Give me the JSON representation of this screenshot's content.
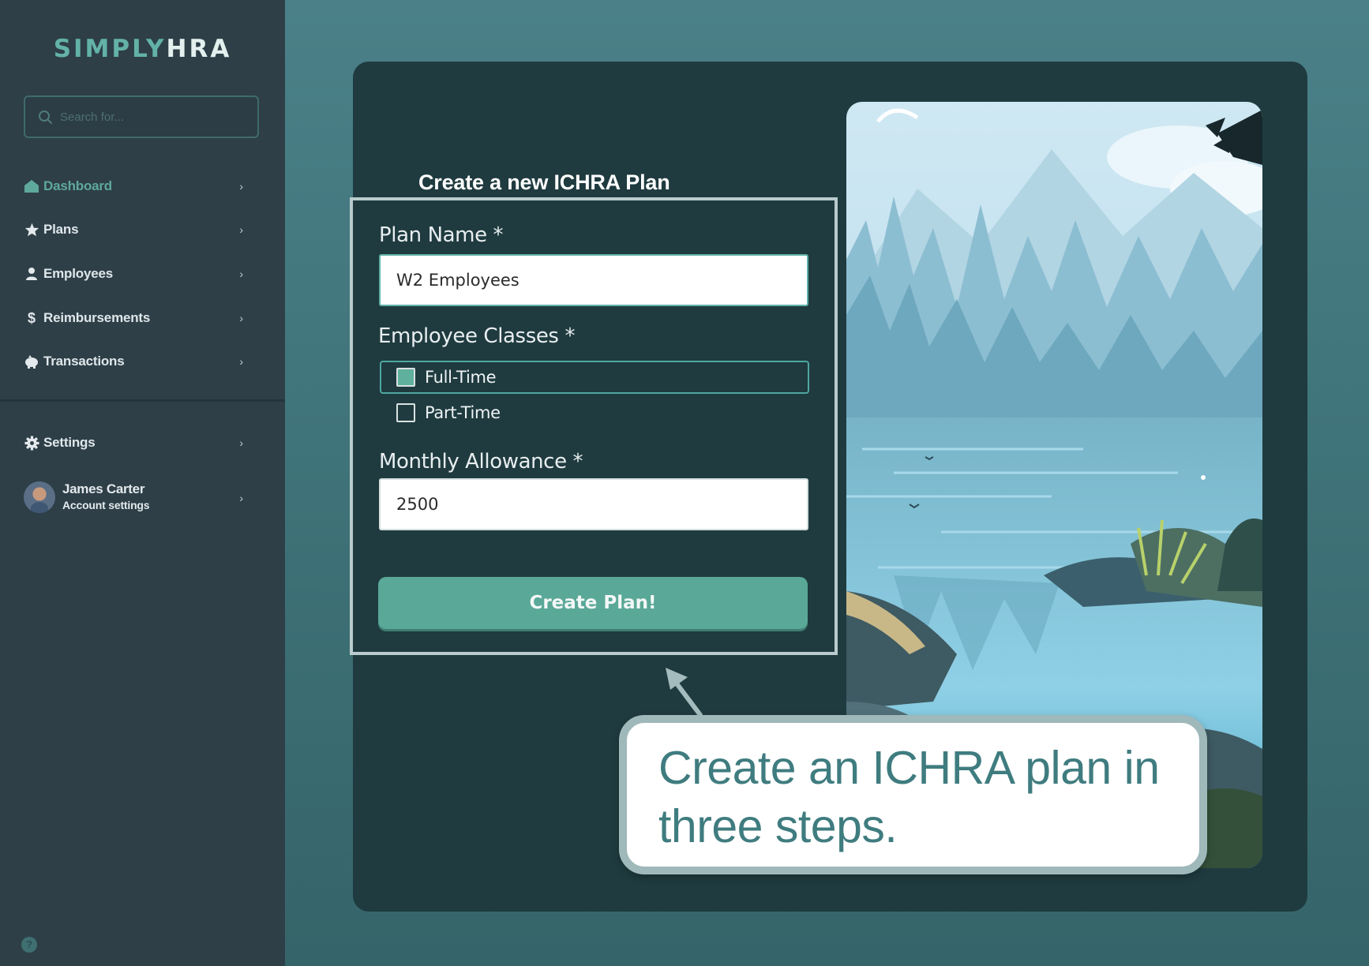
{
  "brand": {
    "part1": "SIMPLY",
    "part2": "HRA"
  },
  "search": {
    "placeholder": "Search for..."
  },
  "sidebar": {
    "items": [
      {
        "label": "Dashboard",
        "icon": "home-icon",
        "active": true
      },
      {
        "label": "Plans",
        "icon": "star-icon",
        "active": false
      },
      {
        "label": "Employees",
        "icon": "person-icon",
        "active": false
      },
      {
        "label": "Reimbursements",
        "icon": "dollar-icon",
        "active": false
      },
      {
        "label": "Transactions",
        "icon": "piggy-bank-icon",
        "active": false
      }
    ],
    "settings": {
      "label": "Settings",
      "icon": "gear-icon"
    },
    "profile": {
      "name": "James Carter",
      "subtitle": "Account settings"
    },
    "help_icon": "help-icon"
  },
  "form": {
    "title": "Create a new ICHRA Plan",
    "plan_name_label": "Plan Name *",
    "plan_name_value": "W2 Employees",
    "classes_label": "Employee Classes *",
    "classes": [
      {
        "label": "Full-Time",
        "checked": true
      },
      {
        "label": "Part-Time",
        "checked": false
      }
    ],
    "allowance_label": "Monthly Allowance *",
    "allowance_value": "2500",
    "submit_label": "Create Plan!"
  },
  "callout": {
    "text": "Create an ICHRA plan in three steps."
  },
  "colors": {
    "accent": "#5aa897",
    "sidebar_bg": "#2e3f48",
    "card_bg": "#1f3b3f",
    "callout_text": "#3f7c7f"
  }
}
